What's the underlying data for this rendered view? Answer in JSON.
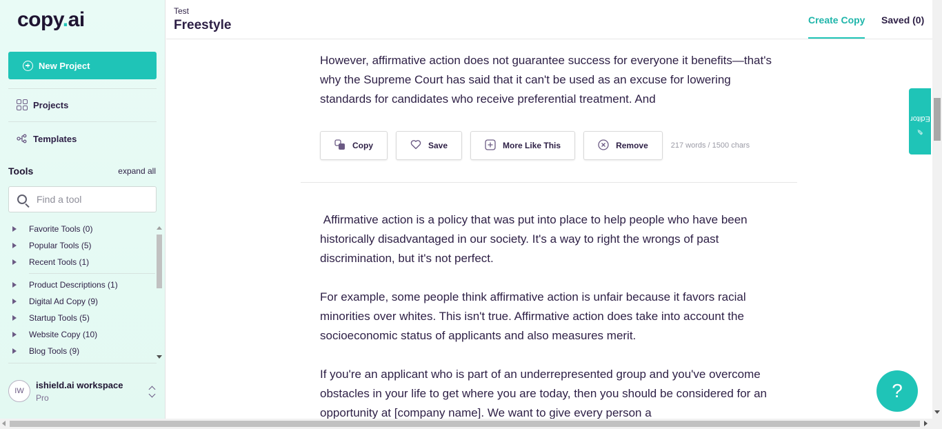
{
  "sidebar": {
    "logo_main": "copy",
    "logo_dot": ".",
    "logo_suffix": "ai",
    "new_project_label": "New Project",
    "nav": [
      {
        "label": "Projects",
        "icon": "grid-icon"
      },
      {
        "label": "Templates",
        "icon": "templates-icon"
      }
    ],
    "tools_heading": "Tools",
    "expand_all": "expand all",
    "search_placeholder": "Find a tool",
    "tool_groups": [
      "Favorite Tools (0)",
      "Popular Tools (5)",
      "Recent Tools (1)",
      "Product Descriptions (1)",
      "Digital Ad Copy (9)",
      "Startup Tools (5)",
      "Website Copy (10)",
      "Blog Tools (9)"
    ],
    "workspace": {
      "initials": "IW",
      "name": "ishield.ai workspace",
      "plan": "Pro"
    }
  },
  "header": {
    "breadcrumb": "Test",
    "title": "Freestyle",
    "tabs": [
      {
        "label": "Create Copy",
        "active": true
      },
      {
        "label": "Saved (0)",
        "active": false
      }
    ]
  },
  "main": {
    "result_1": {
      "text": "However, affirmative action does not guarantee success for everyone it benefits—that's why the Supreme Court has said that it can't be used as an excuse for lowering standards for candidates who receive preferential treatment. And",
      "actions": {
        "copy": "Copy",
        "save": "Save",
        "more": "More Like This",
        "remove": "Remove"
      },
      "counts": "217 words / 1500 chars"
    },
    "result_2": {
      "paragraphs": [
        " Affirmative action is a policy that was put into place to help people who have been historically disadvantaged in our society. It's a way to right the wrongs of past discrimination, but it's not perfect.",
        "For example, some people think affirmative action is unfair because it favors racial minorities over whites. This isn't true. Affirmative action does take into account the socioeconomic status of applicants and also measures merit.",
        "If you're an applicant who is part of an underrepresented group and you've overcome obstacles in your life to get where you are today, then you should be considered for an opportunity at [company name]. We want to give every person a"
      ]
    }
  },
  "editor_tab": "Editor",
  "help_label": "?",
  "colors": {
    "accent": "#1fc4b7",
    "text": "#2d1f45",
    "sidebar_bg": "#e6faf4"
  }
}
